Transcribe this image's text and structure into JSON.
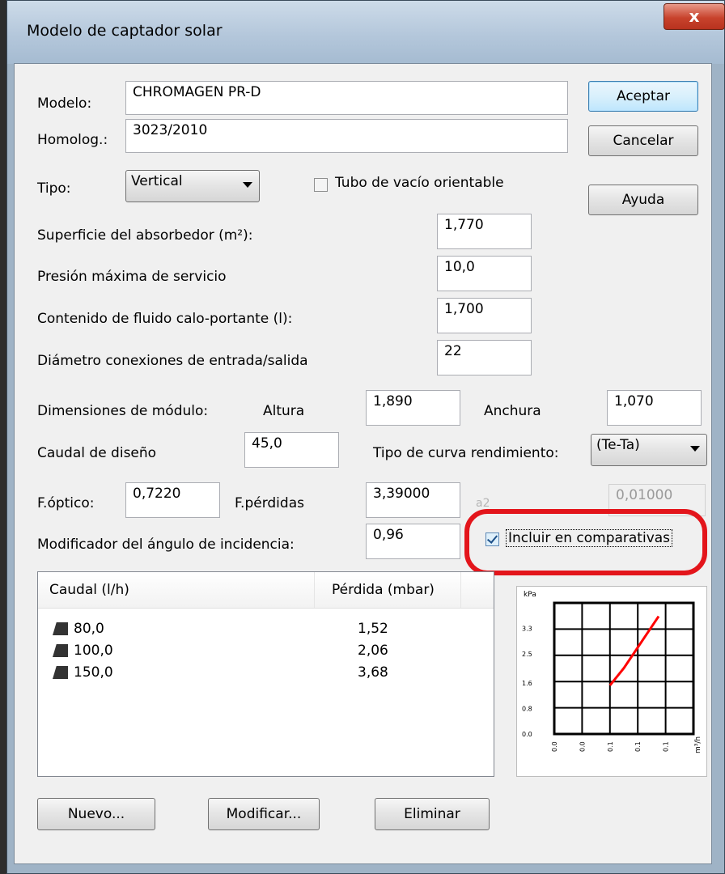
{
  "window": {
    "title": "Modelo de captador solar",
    "close": "x"
  },
  "fields": {
    "modelo": {
      "label": "Modelo:",
      "value": "CHROMAGEN PR-D"
    },
    "homolog": {
      "label": "Homolog.:",
      "value": "3023/2010"
    },
    "tipo": {
      "label": "Tipo:",
      "value": "Vertical"
    },
    "tubo": {
      "label": "Tubo de vacío orientable",
      "checked": false
    },
    "superficie": {
      "label": "Superficie del absorbedor (m²):",
      "value": "1,770"
    },
    "presion": {
      "label": "Presión máxima de servicio",
      "value": "10,0"
    },
    "contenido": {
      "label": "Contenido de fluido calo-portante (l):",
      "value": "1,700"
    },
    "diametro": {
      "label": "Diámetro conexiones de entrada/salida",
      "value": "22"
    },
    "dimensiones": {
      "label": "Dimensiones de módulo:",
      "altura_label": "Altura",
      "altura": "1,890",
      "anchura_label": "Anchura",
      "anchura": "1,070"
    },
    "caudal": {
      "label": "Caudal de diseño",
      "value": "45,0"
    },
    "curva": {
      "label": "Tipo de curva rendimiento:",
      "value": "(Te-Ta)"
    },
    "foptico": {
      "label": "F.óptico:",
      "value": "0,7220"
    },
    "fperdidas": {
      "label": "F.pérdidas",
      "value": "3,39000"
    },
    "a2": {
      "label": "a2",
      "value": "0,01000"
    },
    "modificador": {
      "label": "Modificador del ángulo de incidencia:",
      "value": "0,96"
    },
    "incluir": {
      "label": "Incluir en comparativas",
      "checked": true
    }
  },
  "buttons": {
    "aceptar": "Aceptar",
    "cancelar": "Cancelar",
    "ayuda": "Ayuda",
    "nuevo": "Nuevo...",
    "modificar": "Modificar...",
    "eliminar": "Eliminar"
  },
  "table": {
    "columns": [
      "Caudal (l/h)",
      "Pérdida (mbar)"
    ],
    "rows": [
      {
        "caudal": "80,0",
        "perdida": "1,52"
      },
      {
        "caudal": "100,0",
        "perdida": "2,06"
      },
      {
        "caudal": "150,0",
        "perdida": "3,68"
      }
    ]
  },
  "chart_data": {
    "type": "line",
    "ylabel": "kPa",
    "xlabel": "m³/h",
    "y_ticks": [
      "0.0",
      "0.8",
      "1.6",
      "2.5",
      "3.3"
    ],
    "x_ticks": [
      "0.0",
      "0.0",
      "0.1",
      "0.1",
      "0.1"
    ],
    "ylim": [
      0,
      4.1
    ],
    "series": [
      {
        "x": [
          0.08,
          0.1,
          0.15
        ],
        "y": [
          1.52,
          2.06,
          3.68
        ]
      }
    ],
    "line_color": "#ff0000"
  }
}
